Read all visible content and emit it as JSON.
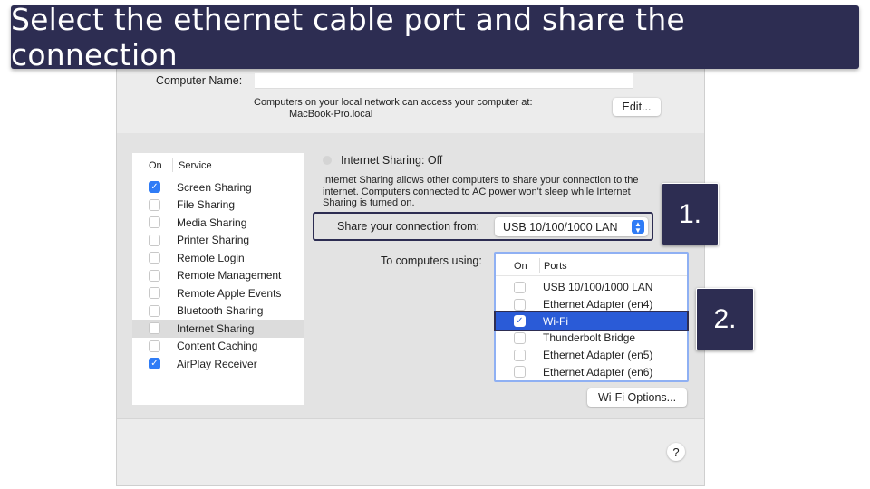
{
  "banner": {
    "title": "Select the ethernet cable port and share the connection"
  },
  "header": {
    "computer_name_label": "Computer Name:",
    "computer_name_value": "",
    "access_text": "Computers on your local network can access your computer at:",
    "hostname": "MacBook-Pro.local",
    "edit_label": "Edit..."
  },
  "services": {
    "col_on": "On",
    "col_service": "Service",
    "items": [
      {
        "label": "Screen Sharing",
        "on": true
      },
      {
        "label": "File Sharing",
        "on": false
      },
      {
        "label": "Media Sharing",
        "on": false
      },
      {
        "label": "Printer Sharing",
        "on": false
      },
      {
        "label": "Remote Login",
        "on": false
      },
      {
        "label": "Remote Management",
        "on": false
      },
      {
        "label": "Remote Apple Events",
        "on": false
      },
      {
        "label": "Bluetooth Sharing",
        "on": false
      },
      {
        "label": "Internet Sharing",
        "on": false,
        "selected": true
      },
      {
        "label": "Content Caching",
        "on": false
      },
      {
        "label": "AirPlay Receiver",
        "on": true
      }
    ]
  },
  "detail": {
    "status": "Internet Sharing: Off",
    "description": "Internet Sharing allows other computers to share your connection to the internet. Computers connected to AC power won't sleep while Internet Sharing is turned on.",
    "share_from_label": "Share your connection from:",
    "share_from_value": "USB 10/100/1000 LAN",
    "to_label": "To computers using:",
    "ports_col_on": "On",
    "ports_col_ports": "Ports",
    "ports": [
      {
        "label": "USB 10/100/1000 LAN",
        "on": false
      },
      {
        "label": "Ethernet Adapter (en4)",
        "on": false
      },
      {
        "label": "Wi-Fi",
        "on": true,
        "selected": true
      },
      {
        "label": "Thunderbolt Bridge",
        "on": false
      },
      {
        "label": "Ethernet Adapter (en5)",
        "on": false
      },
      {
        "label": "Ethernet Adapter (en6)",
        "on": false
      }
    ],
    "wifi_options_label": "Wi-Fi Options..."
  },
  "steps": {
    "step1": "1.",
    "step2": "2."
  },
  "help": {
    "label": "?"
  },
  "colors": {
    "accent": "#2f7cf6",
    "selection": "#2a5bd7",
    "banner": "#2d2d52"
  }
}
